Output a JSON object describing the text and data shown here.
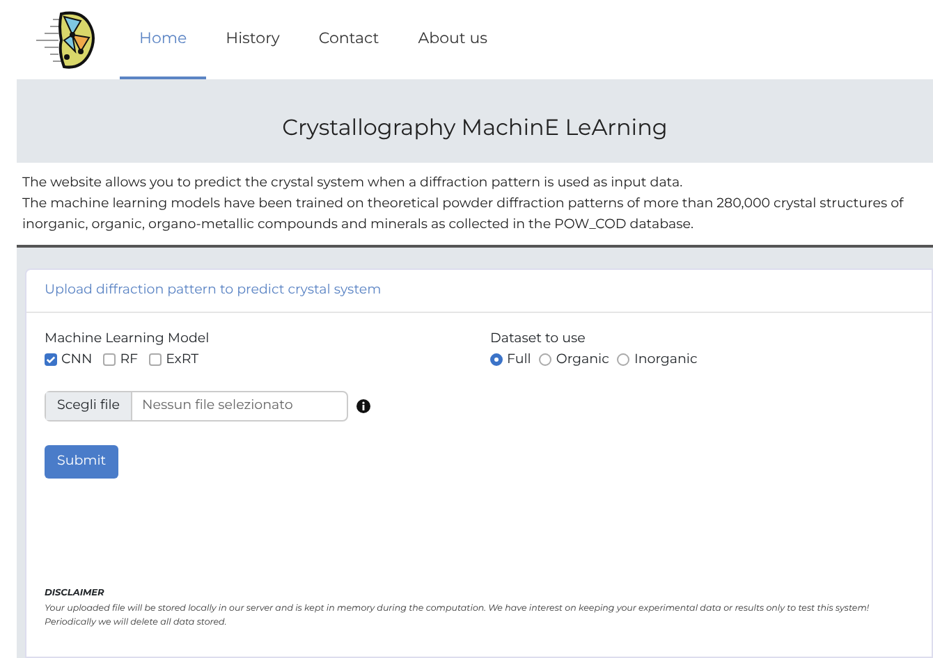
{
  "nav": {
    "items": [
      {
        "label": "Home",
        "selected": true
      },
      {
        "label": "History",
        "selected": false
      },
      {
        "label": "Contact",
        "selected": false
      },
      {
        "label": "About us",
        "selected": false
      }
    ]
  },
  "title": "Crystallography MachinE LeArning",
  "description": [
    "The website allows you to predict the crystal system when a diffraction pattern is used as input data.",
    "The machine learning models have been trained on theoretical powder diffraction patterns of more than 280,000 crystal structures of inorganic, organic, organo-metallic compounds and minerals as collected in the POW_COD database."
  ],
  "card": {
    "header": "Upload diffraction pattern to predict crystal system",
    "model": {
      "label": "Machine Learning Model",
      "options": [
        {
          "label": "CNN",
          "checked": true
        },
        {
          "label": "RF",
          "checked": false
        },
        {
          "label": "ExRT",
          "checked": false
        }
      ]
    },
    "dataset": {
      "label": "Dataset to use",
      "options": [
        {
          "label": "Full",
          "selected": true
        },
        {
          "label": "Organic",
          "selected": false
        },
        {
          "label": "Inorganic",
          "selected": false
        }
      ]
    },
    "file": {
      "button": "Scegli file",
      "value": "Nessun file selezionato"
    },
    "submit": "Submit",
    "disclaimer": {
      "title": "DISCLAIMER",
      "text": "Your uploaded file will be stored locally in our server and is kept in memory during the computation. We have interest on keeping your experimental data or results only to test this system! Periodically we will delete all data stored."
    }
  }
}
